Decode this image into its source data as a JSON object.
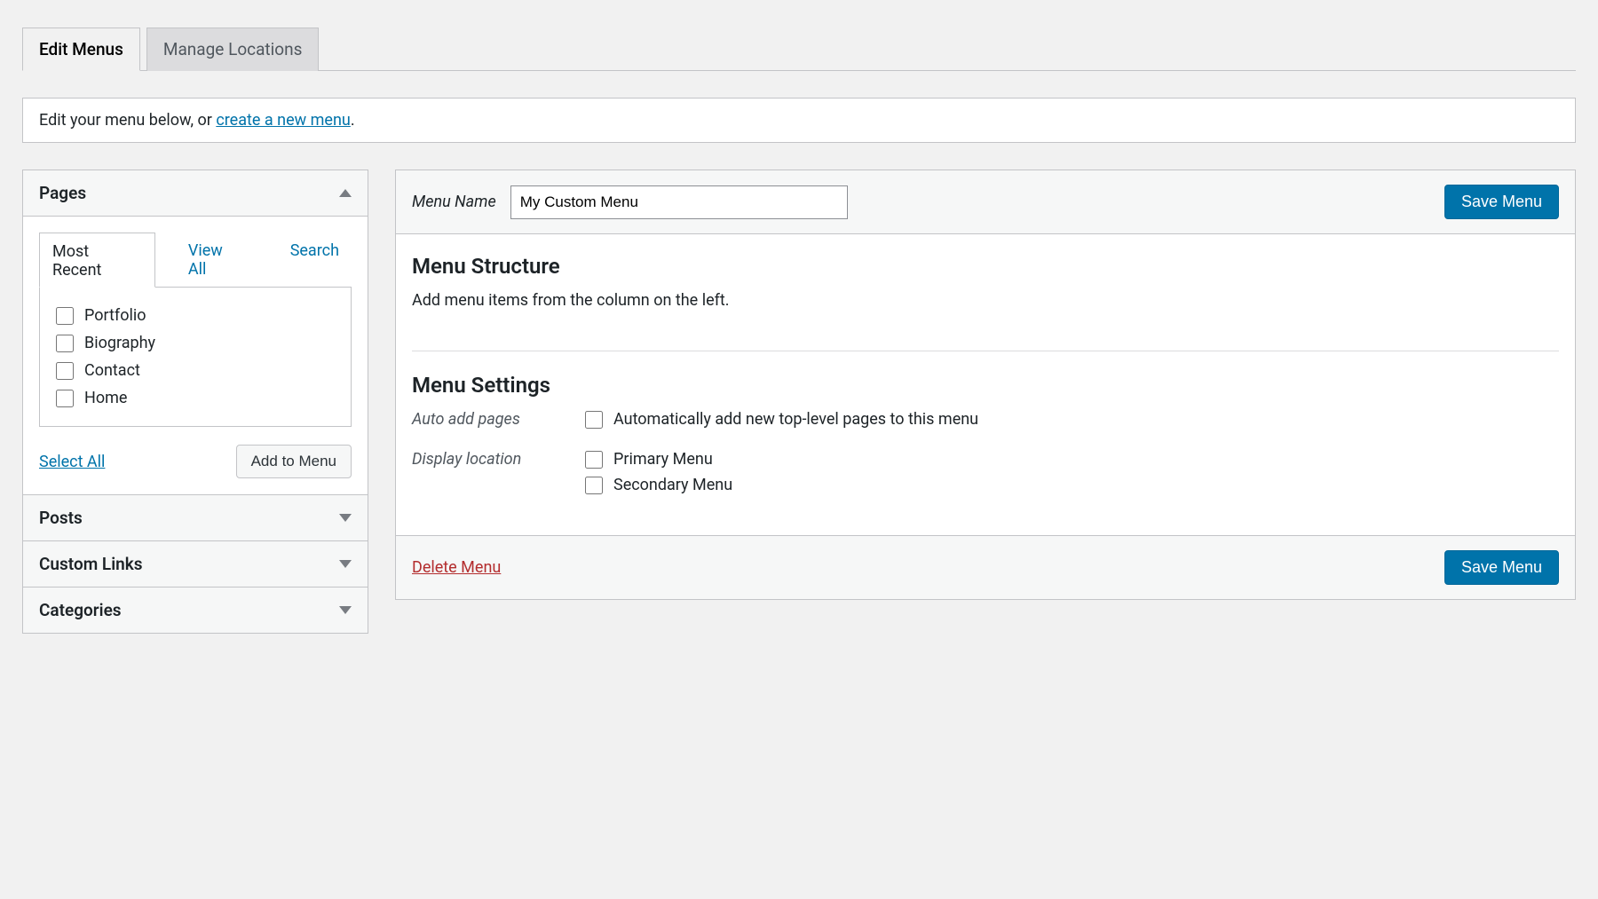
{
  "tabs": [
    {
      "label": "Edit Menus",
      "active": true
    },
    {
      "label": "Manage Locations",
      "active": false
    }
  ],
  "info": {
    "prefix": "Edit your menu below, or ",
    "link": "create a new menu",
    "suffix": "."
  },
  "metaboxes": {
    "pages": {
      "title": "Pages",
      "subtabs": [
        "Most Recent",
        "View All",
        "Search"
      ],
      "items": [
        "Portfolio",
        "Biography",
        "Contact",
        "Home"
      ],
      "select_all": "Select All",
      "add_button": "Add to Menu"
    },
    "posts": {
      "title": "Posts"
    },
    "custom_links": {
      "title": "Custom Links"
    },
    "categories": {
      "title": "Categories"
    }
  },
  "menu": {
    "name_label": "Menu Name",
    "name_value": "My Custom Menu",
    "save_button": "Save Menu",
    "structure_title": "Menu Structure",
    "structure_desc": "Add menu items from the column on the left.",
    "settings_title": "Menu Settings",
    "auto_add_label": "Auto add pages",
    "auto_add_option": "Automatically add new top-level pages to this menu",
    "display_label": "Display location",
    "locations": [
      "Primary Menu",
      "Secondary Menu"
    ],
    "delete": "Delete Menu"
  }
}
